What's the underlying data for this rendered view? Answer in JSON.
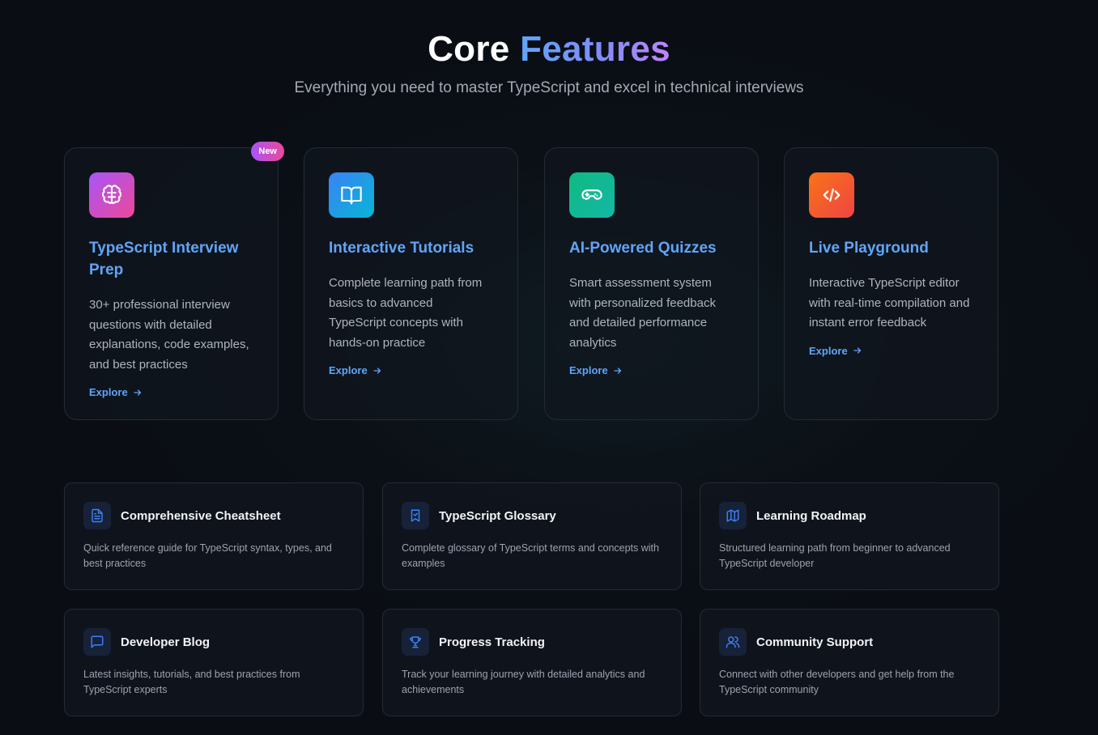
{
  "header": {
    "title_part1": "Core",
    "title_part2": "Features",
    "subtitle": "Everything you need to master TypeScript and excel in technical interviews"
  },
  "core_features": [
    {
      "title": "TypeScript Interview Prep",
      "description": "30+ professional interview questions with detailed explanations, code examples, and best practices",
      "cta": "Explore",
      "badge": "New",
      "icon": "brain-icon",
      "gradient": [
        "#a855f7",
        "#ec4899"
      ]
    },
    {
      "title": "Interactive Tutorials",
      "description": "Complete learning path from basics to advanced TypeScript concepts with hands-on practice",
      "cta": "Explore",
      "icon": "book-open-icon",
      "gradient": [
        "#3b82f6",
        "#06b6d4"
      ]
    },
    {
      "title": "AI-Powered Quizzes",
      "description": "Smart assessment system with personalized feedback and detailed performance analytics",
      "cta": "Explore",
      "icon": "gamepad-icon",
      "gradient": [
        "#10b981",
        "#14b8a6"
      ]
    },
    {
      "title": "Live Playground",
      "description": "Interactive TypeScript editor with real-time compilation and instant error feedback",
      "cta": "Explore",
      "icon": "code-icon",
      "gradient": [
        "#f97316",
        "#ef4444"
      ]
    }
  ],
  "resources": [
    {
      "title": "Comprehensive Cheatsheet",
      "description": "Quick reference guide for TypeScript syntax, types, and best practices",
      "icon": "file-text-icon"
    },
    {
      "title": "TypeScript Glossary",
      "description": "Complete glossary of TypeScript terms and concepts with examples",
      "icon": "bookmark-icon"
    },
    {
      "title": "Learning Roadmap",
      "description": "Structured learning path from beginner to advanced TypeScript developer",
      "icon": "map-icon"
    },
    {
      "title": "Developer Blog",
      "description": "Latest insights, tutorials, and best practices from TypeScript experts",
      "icon": "message-square-icon"
    },
    {
      "title": "Progress Tracking",
      "description": "Track your learning journey with detailed analytics and achievements",
      "icon": "trophy-icon"
    },
    {
      "title": "Community Support",
      "description": "Connect with other developers and get help from the TypeScript community",
      "icon": "users-icon"
    }
  ],
  "colors": {
    "accent": "#60a5fa",
    "mini_icon": "#3b82f6"
  }
}
